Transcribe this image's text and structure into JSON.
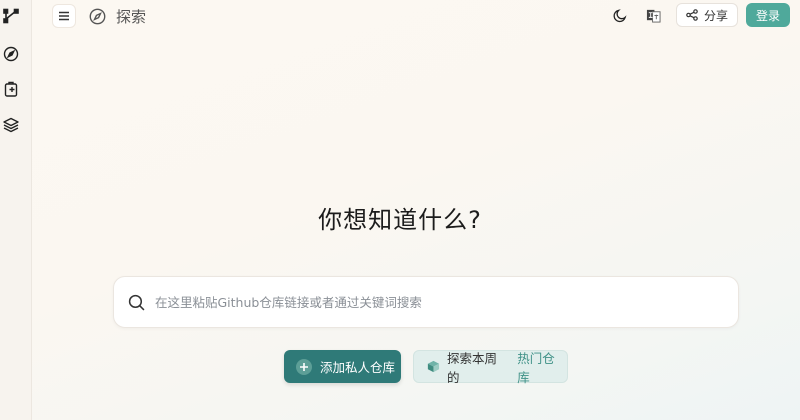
{
  "header": {
    "section_title": "探索",
    "share_label": "分享",
    "login_label": "登录",
    "lang_icon": "translate-icon",
    "theme_icon": "moon-icon"
  },
  "main": {
    "heading": "你想知道什么?",
    "search_placeholder": "在这里粘贴Github仓库链接或者通过关键词搜索",
    "add_private_label": "添加私人仓库",
    "hot_prefix": "探索本周的",
    "hot_highlight": "热门仓库"
  },
  "sidebar": {
    "items": [
      {
        "icon": "graph-icon"
      },
      {
        "icon": "compass-icon"
      },
      {
        "icon": "clipboard-icon"
      },
      {
        "icon": "layers-icon"
      }
    ]
  },
  "colors": {
    "accent": "#4fa99b",
    "primary_button": "#2f7a78",
    "secondary_button": "#e1eeec",
    "highlight_text": "#3f9187"
  }
}
